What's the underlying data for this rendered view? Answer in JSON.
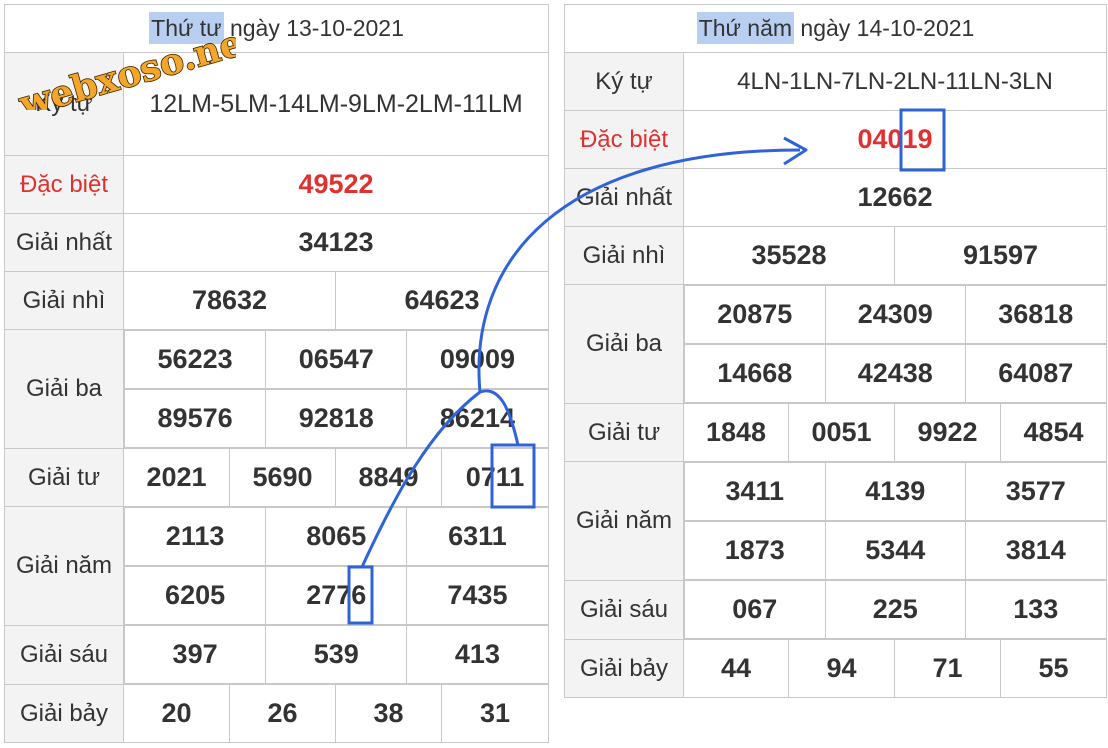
{
  "watermark": "webxoso.net",
  "left": {
    "weekday": "Thứ tư",
    "date_text": "ngày 13-10-2021",
    "kytu_label": "Ký tự",
    "kytu_value": "12LM-5LM-14LM-9LM-2LM-11LM",
    "labels": {
      "db": "Đặc biệt",
      "g1": "Giải nhất",
      "g2": "Giải nhì",
      "g3": "Giải ba",
      "g4": "Giải tư",
      "g5": "Giải năm",
      "g6": "Giải sáu",
      "g7": "Giải bảy"
    },
    "db": "49522",
    "g1": "34123",
    "g2": [
      "78632",
      "64623"
    ],
    "g3": [
      "56223",
      "06547",
      "09009",
      "89576",
      "92818",
      "86214"
    ],
    "g4": [
      "2021",
      "5690",
      "8849",
      "0711"
    ],
    "g5": [
      "2113",
      "8065",
      "6311",
      "6205",
      "2776",
      "7435"
    ],
    "g6": [
      "397",
      "539",
      "413"
    ],
    "g7": [
      "20",
      "26",
      "38",
      "31"
    ]
  },
  "right": {
    "weekday": "Thứ năm",
    "date_text": "ngày 14-10-2021",
    "kytu_label": "Ký tự",
    "kytu_value": "4LN-1LN-7LN-2LN-11LN-3LN",
    "labels": {
      "db": "Đặc biệt",
      "g1": "Giải nhất",
      "g2": "Giải nhì",
      "g3": "Giải ba",
      "g4": "Giải tư",
      "g5": "Giải năm",
      "g6": "Giải sáu",
      "g7": "Giải bảy"
    },
    "db": "04019",
    "g1": "12662",
    "g2": [
      "35528",
      "91597"
    ],
    "g3": [
      "20875",
      "24309",
      "36818",
      "14668",
      "42438",
      "64087"
    ],
    "g4": [
      "1848",
      "0051",
      "9922",
      "4854"
    ],
    "g5": [
      "3411",
      "4139",
      "3577",
      "1873",
      "5344",
      "3814"
    ],
    "g6": [
      "067",
      "225",
      "133"
    ],
    "g7": [
      "44",
      "94",
      "71",
      "55"
    ]
  },
  "colors": {
    "special": "#e03030",
    "annotation": "#2f63d8",
    "header_highlight": "#b9cff2",
    "watermark_fill": "#f4a62a"
  }
}
